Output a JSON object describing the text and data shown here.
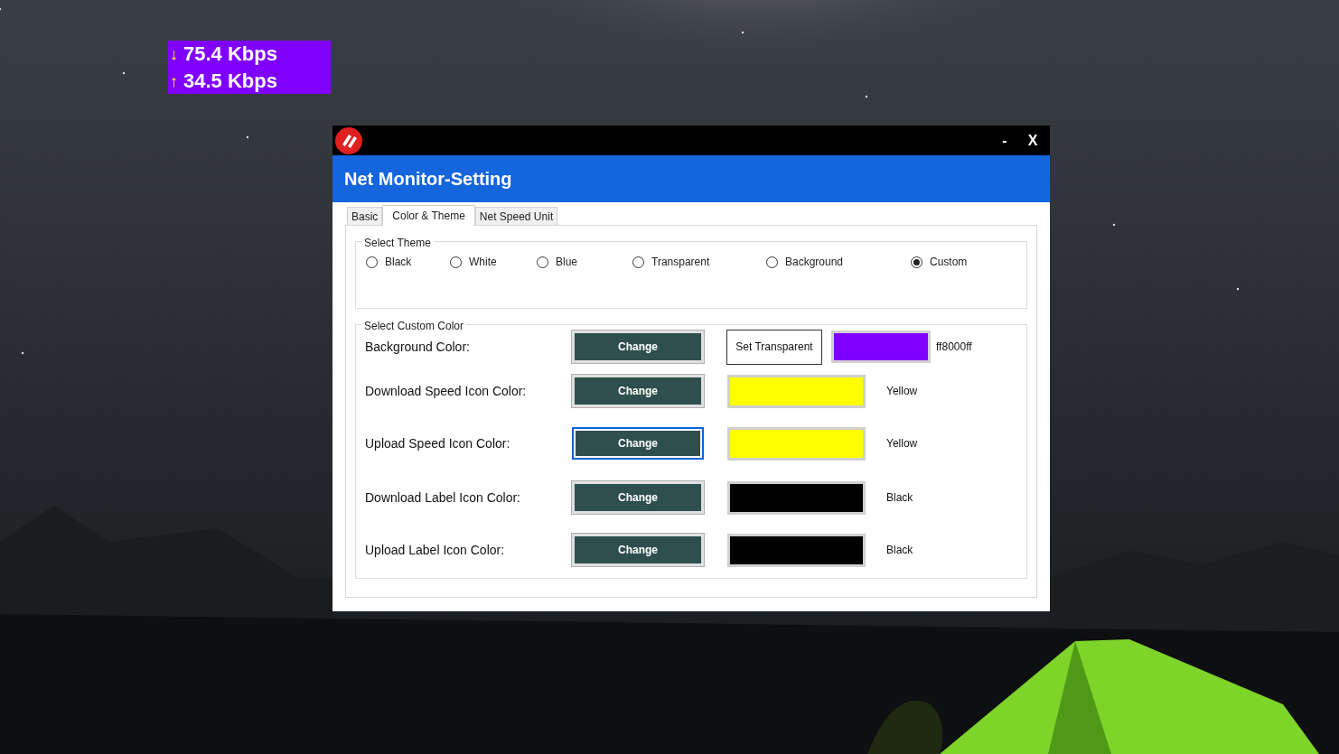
{
  "speed_widget": {
    "download": {
      "arrow": "↓",
      "text": "75.4 Kbps"
    },
    "upload": {
      "arrow": "↑",
      "text": "34.5 Kbps"
    }
  },
  "window": {
    "minimize": "-",
    "close": "X",
    "title": "Net Monitor-Setting"
  },
  "tabs": [
    {
      "label": "Basic",
      "selected": false
    },
    {
      "label": "Color & Theme",
      "selected": true
    },
    {
      "label": "Net Speed Unit",
      "selected": false
    }
  ],
  "theme_group": {
    "title": "Select Theme",
    "options": [
      {
        "label": "Black",
        "selected": false
      },
      {
        "label": "White",
        "selected": false
      },
      {
        "label": "Blue",
        "selected": false
      },
      {
        "label": "Transparent",
        "selected": false
      },
      {
        "label": "Background",
        "selected": false
      },
      {
        "label": "Custom",
        "selected": true
      }
    ]
  },
  "custom_group": {
    "title": "Select Custom Color",
    "rows": [
      {
        "label": "Background Color:",
        "button": "Change",
        "focused": false,
        "extra_button": "Set Transparent",
        "color": "#8000ff",
        "color_name": "ff8000ff"
      },
      {
        "label": "Download Speed Icon Color:",
        "button": "Change",
        "focused": false,
        "color": "#ffff00",
        "color_name": "Yellow"
      },
      {
        "label": "Upload Speed Icon Color:",
        "button": "Change",
        "focused": true,
        "color": "#ffff00",
        "color_name": "Yellow"
      },
      {
        "label": "Download Label Icon Color:",
        "button": "Change",
        "focused": false,
        "color": "#000000",
        "color_name": "Black"
      },
      {
        "label": "Upload Label Icon Color:",
        "button": "Change",
        "focused": false,
        "color": "#000000",
        "color_name": "Black"
      }
    ]
  }
}
